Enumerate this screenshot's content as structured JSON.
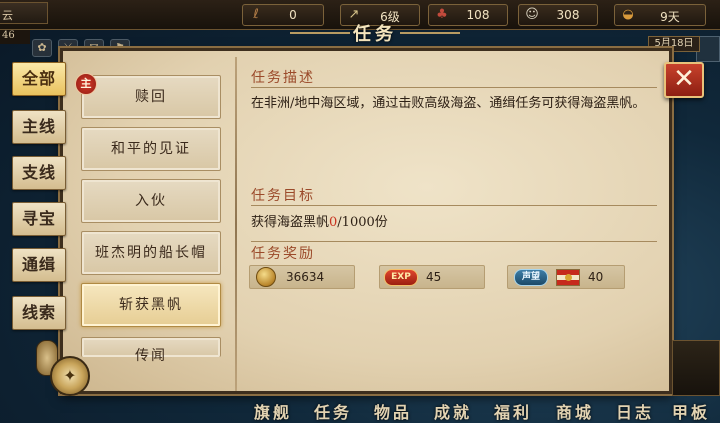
{
  "topbar": {
    "left_stub": "云",
    "left_small": "46",
    "resources": [
      {
        "icon": "wood-icon",
        "glyph": "ℓ",
        "value": "0"
      },
      {
        "icon": "level-icon",
        "glyph": "↗",
        "value": "6级"
      },
      {
        "icon": "crew-icon",
        "glyph": "♣",
        "value": "108"
      },
      {
        "icon": "sailor-icon",
        "glyph": "☺",
        "value": "308"
      },
      {
        "icon": "food-icon",
        "glyph": "◒",
        "value": "9天"
      }
    ],
    "date": "5月18日"
  },
  "title": "任务",
  "categories": [
    {
      "label": "全部",
      "active": true
    },
    {
      "label": "主线",
      "active": false
    },
    {
      "label": "支线",
      "active": false
    },
    {
      "label": "寻宝",
      "active": false
    },
    {
      "label": "通缉",
      "active": false
    },
    {
      "label": "线索",
      "active": false
    }
  ],
  "tasks": [
    {
      "label": "赎回",
      "badge": "主"
    },
    {
      "label": "和平的见证"
    },
    {
      "label": "入伙"
    },
    {
      "label": "班杰明的船长帽"
    },
    {
      "label": "斩获黑帆",
      "selected": true
    },
    {
      "label": "传闻"
    }
  ],
  "detail": {
    "desc_title": "任务描述",
    "desc_text": "在非洲/地中海区域，通过击败高级海盗、通缉任务可获得海盗黑帆。",
    "goal_title": "任务目标",
    "goal_prefix": "获得海盗黑帆",
    "goal_current": "0",
    "goal_suffix": "/1000份",
    "reward_title": "任务奖励",
    "rewards": {
      "coin": "36634",
      "exp_label": "EXP",
      "exp": "45",
      "rep_label": "声望",
      "rep": "40"
    }
  },
  "close_label": "✕",
  "bottom_nav": [
    "旗舰",
    "任务",
    "物品",
    "成就",
    "福利",
    "商城",
    "日志",
    "甲板"
  ],
  "colors": {
    "accent_red": "#c8321e",
    "title_brown": "#9b4a2a",
    "parchment": "#e3d3b4",
    "selected_gold": "#e6cd93"
  }
}
